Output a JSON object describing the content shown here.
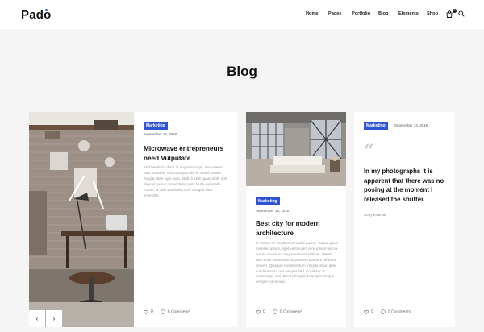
{
  "brand": {
    "name": "Pado"
  },
  "nav": {
    "items": [
      {
        "label": "Home"
      },
      {
        "label": "Pages"
      },
      {
        "label": "Portfolio"
      },
      {
        "label": "Blog"
      },
      {
        "label": "Elements"
      },
      {
        "label": "Shop"
      }
    ],
    "active": "Blog",
    "cart_count": "0"
  },
  "page": {
    "title": "Blog"
  },
  "posts": [
    {
      "category": "Marketing",
      "date": "September 12, 2018",
      "title": "Microwave entrepreneurs need Vulputate",
      "excerpt": "Sed hendrerit dolor at augue suscipit, nec viverra odio posuere. Vivamus quis nisl et metus ornare feugiat vitae eget nunc. Nullo luctus quam nibh, non aliquam purus consectetur quis. Nulla venenatis mauris id odio vestibulum, eu tristique nibh imperdiet.",
      "likes": "0",
      "comments": "0 Comments",
      "prev": "‹",
      "next": "›"
    },
    {
      "category": "Marketing",
      "date": "September 12, 2018",
      "title": "Best city for modern architecture",
      "excerpt": "In mattis, mi tincidunt convallis auctor, massa quam molestie ipsum, eget vestibulum eros ipsum lacinia quam. Vivamus congue semper pretium. Mauris nibh dolor, venenatis ac posuere posuere, efficitur vel orci. Quisque condimentum fringilla dolor, quis condimentum nisi semper sed. Curabitur ac scelerisque orci. Donec feugiat dolor quis tempor semper commodo.",
      "likes": "0",
      "comments": "0 Comments"
    },
    {
      "category": "Marketing",
      "date": "September 12, 2018",
      "quote": "In my photographs it is apparent that there was no posing at the moment I released the shutter.",
      "author": "Jerzy Kosinski",
      "likes": "0",
      "comments": "0 Comments"
    }
  ],
  "colors": {
    "accent": "#2f55d4",
    "background": "#f5f5f5"
  },
  "icons": [
    "cart-icon",
    "search-icon",
    "heart-icon",
    "comment-icon",
    "quote-icon",
    "chevron-left-icon",
    "chevron-right-icon"
  ]
}
